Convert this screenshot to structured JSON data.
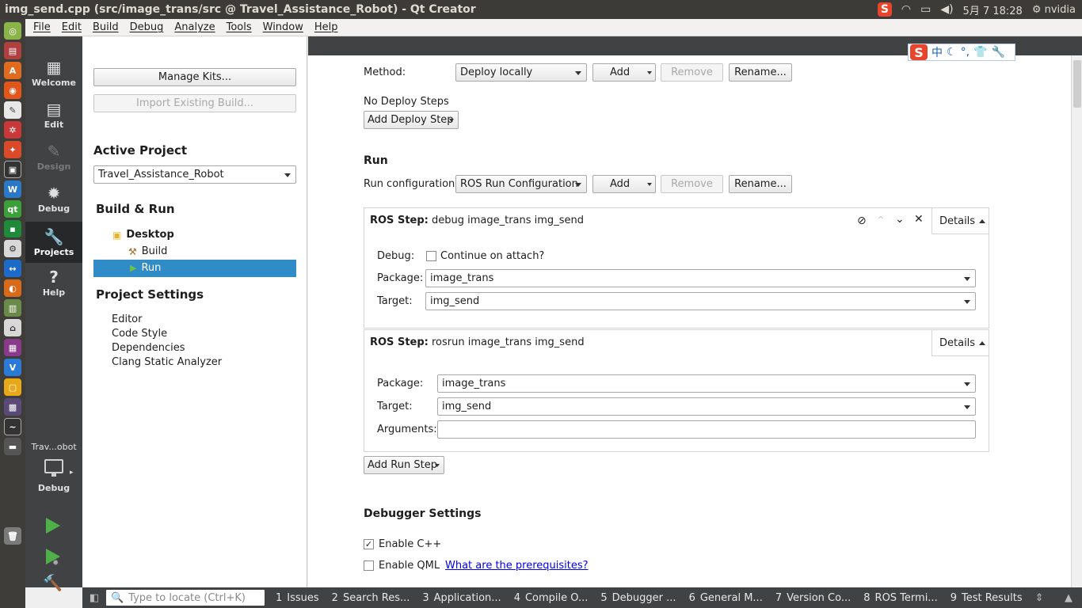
{
  "window": {
    "title": "img_send.cpp (src/image_trans/src @ Travel_Assistance_Robot) - Qt Creator"
  },
  "tray": {
    "ime": "S",
    "date": "5月 7 18:28",
    "user": "nvidia"
  },
  "menu": [
    "File",
    "Edit",
    "Build",
    "Debug",
    "Analyze",
    "Tools",
    "Window",
    "Help"
  ],
  "modes": {
    "welcome": "Welcome",
    "edit": "Edit",
    "design": "Design",
    "debug": "Debug",
    "projects": "Projects",
    "help": "Help"
  },
  "kit_selector": {
    "project": "Trav...obot",
    "config": "Debug"
  },
  "left": {
    "manage_kits": "Manage Kits...",
    "import_build": "Import Existing Build...",
    "active_project_heading": "Active Project",
    "active_project": "Travel_Assistance_Robot",
    "build_run_heading": "Build & Run",
    "kit": "Desktop",
    "build": "Build",
    "run": "Run",
    "project_settings_heading": "Project Settings",
    "settings": [
      "Editor",
      "Code Style",
      "Dependencies",
      "Clang Static Analyzer"
    ]
  },
  "deploy": {
    "method_label": "Method:",
    "method_value": "Deploy locally",
    "add": "Add",
    "remove": "Remove",
    "rename": "Rename...",
    "no_steps": "No Deploy Steps",
    "add_step": "Add Deploy Step"
  },
  "run": {
    "heading": "Run",
    "config_label": "Run configuration:",
    "config_value": "ROS Run Configuration",
    "add": "Add",
    "remove": "Remove",
    "rename": "Rename...",
    "step1": {
      "title_bold": "ROS Step:",
      "title_rest": " debug image_trans img_send",
      "details": "Details",
      "debug_label": "Debug:",
      "continue_label": "Continue on attach?",
      "package_label": "Package:",
      "package_value": "image_trans",
      "target_label": "Target:",
      "target_value": "img_send"
    },
    "step2": {
      "title_bold": "ROS Step:",
      "title_rest": " rosrun image_trans img_send",
      "details": "Details",
      "package_label": "Package:",
      "package_value": "image_trans",
      "target_label": "Target:",
      "target_value": "img_send",
      "arguments_label": "Arguments:",
      "arguments_value": ""
    },
    "add_step": "Add Run Step"
  },
  "debugger": {
    "heading": "Debugger Settings",
    "enable_cpp": "Enable C++",
    "enable_qml": "Enable QML",
    "prereq_link": "What are the prerequisites?"
  },
  "statusbar": {
    "locator_placeholder": "Type to locate (Ctrl+K)",
    "tabs": [
      {
        "n": "1",
        "label": "Issues"
      },
      {
        "n": "2",
        "label": "Search Res..."
      },
      {
        "n": "3",
        "label": "Application..."
      },
      {
        "n": "4",
        "label": "Compile O..."
      },
      {
        "n": "5",
        "label": "Debugger ..."
      },
      {
        "n": "6",
        "label": "General M..."
      },
      {
        "n": "7",
        "label": "Version Co..."
      },
      {
        "n": "8",
        "label": "ROS Termi..."
      },
      {
        "n": "9",
        "label": "Test Results"
      }
    ]
  },
  "colors": {
    "accent": "#308cc6",
    "modebar": "#404244",
    "run_green": "#4fb04a"
  }
}
